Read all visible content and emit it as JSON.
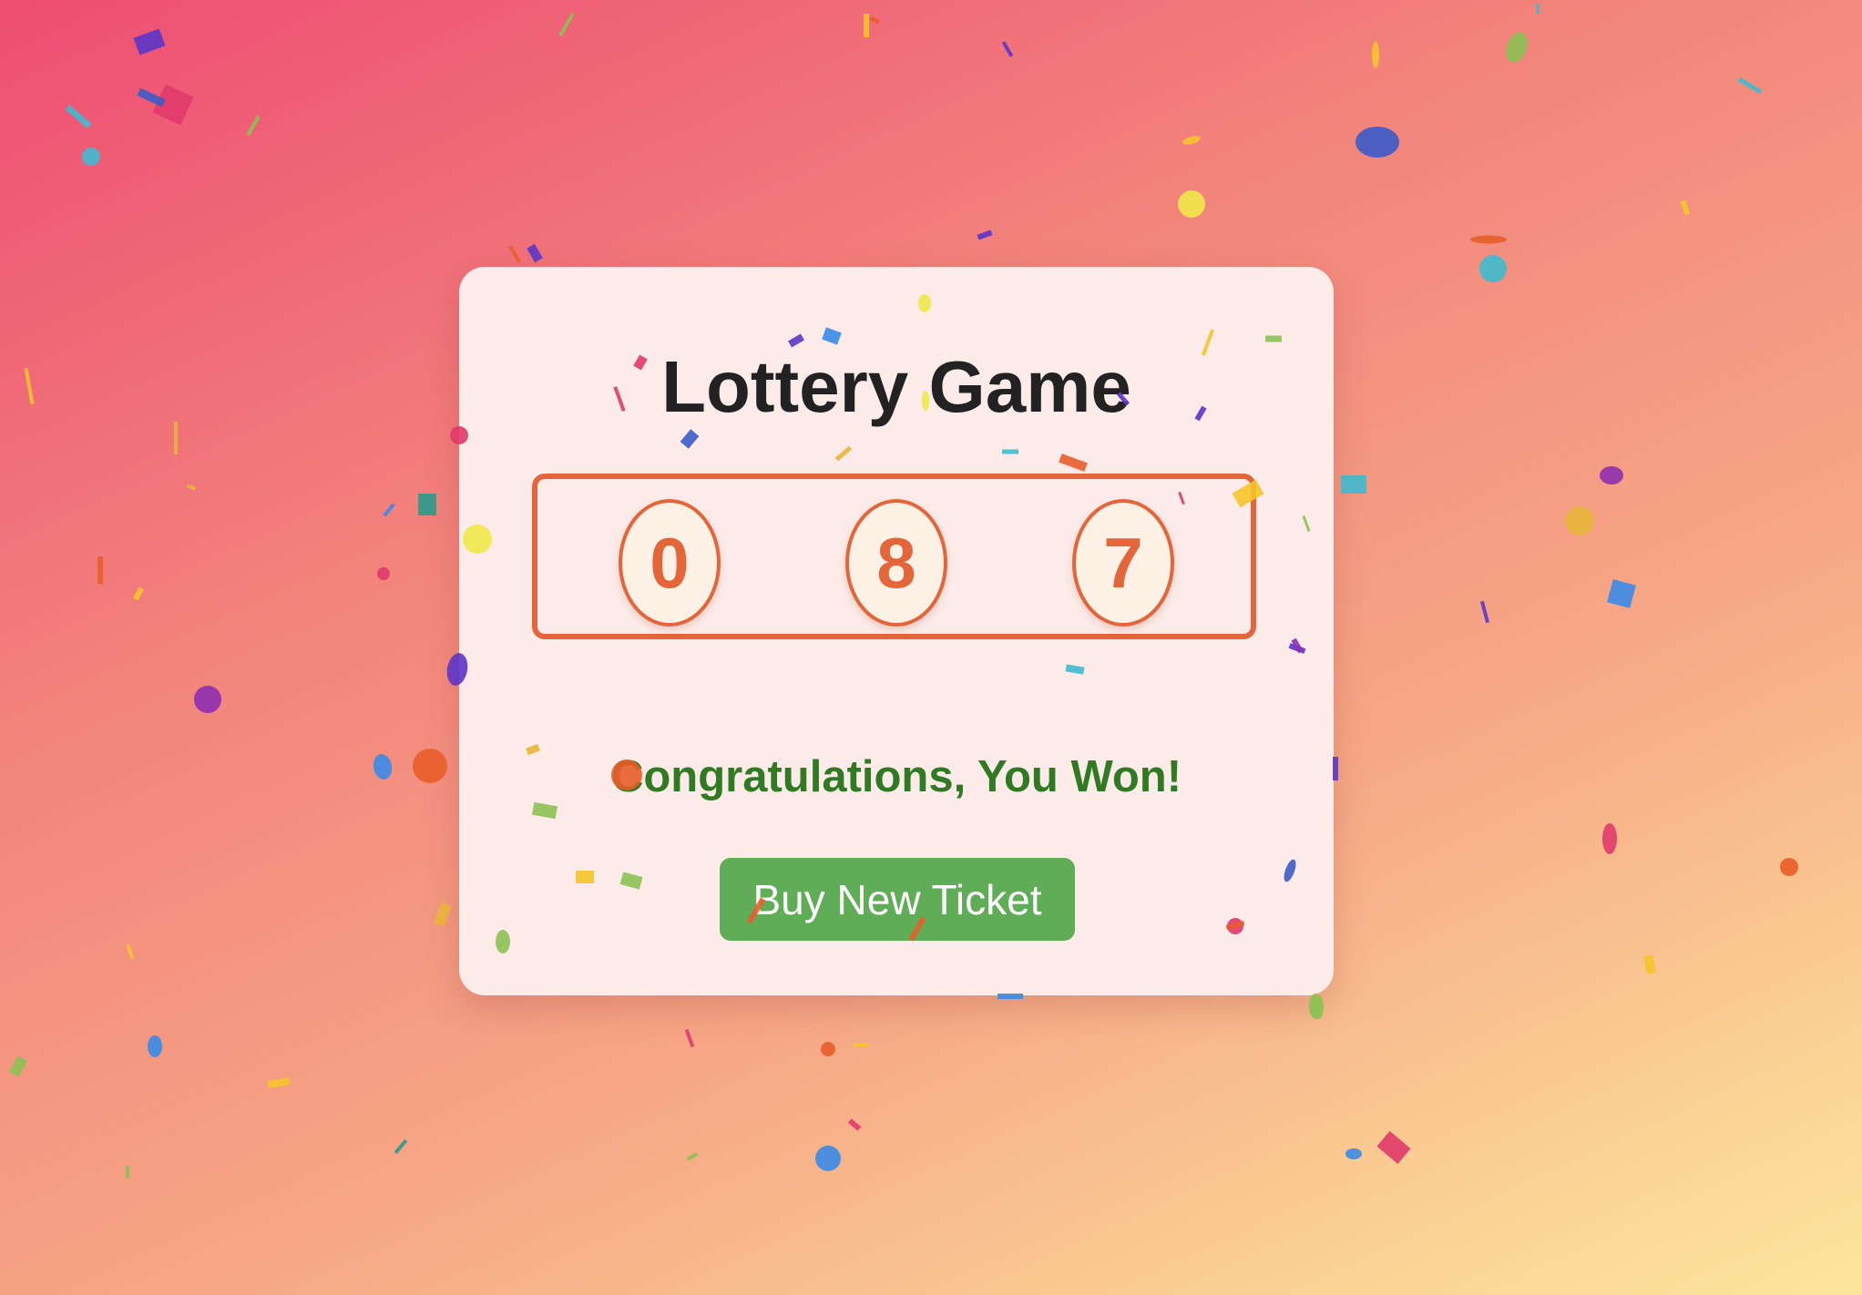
{
  "game": {
    "title": "Lottery Game",
    "numbers": [
      "0",
      "8",
      "7"
    ],
    "result_message": "Congratulations, You Won!",
    "buy_button_label": "Buy New Ticket"
  },
  "theme": {
    "accent": "#e5653a",
    "success": "#2f7a22",
    "button": "#5fad57",
    "card_background": "#fcebe9",
    "gradient": [
      "#ee4d73",
      "#f6a886",
      "#fde59c"
    ]
  },
  "confetti_colors": [
    "#5c35c9",
    "#e03a6a",
    "#3fbad0",
    "#f5c52a",
    "#8cc152",
    "#e85d2a",
    "#3b5cc9",
    "#3a8be8",
    "#8e2fb0",
    "#2a9a8a",
    "#e8b53a",
    "#f0e84a"
  ]
}
